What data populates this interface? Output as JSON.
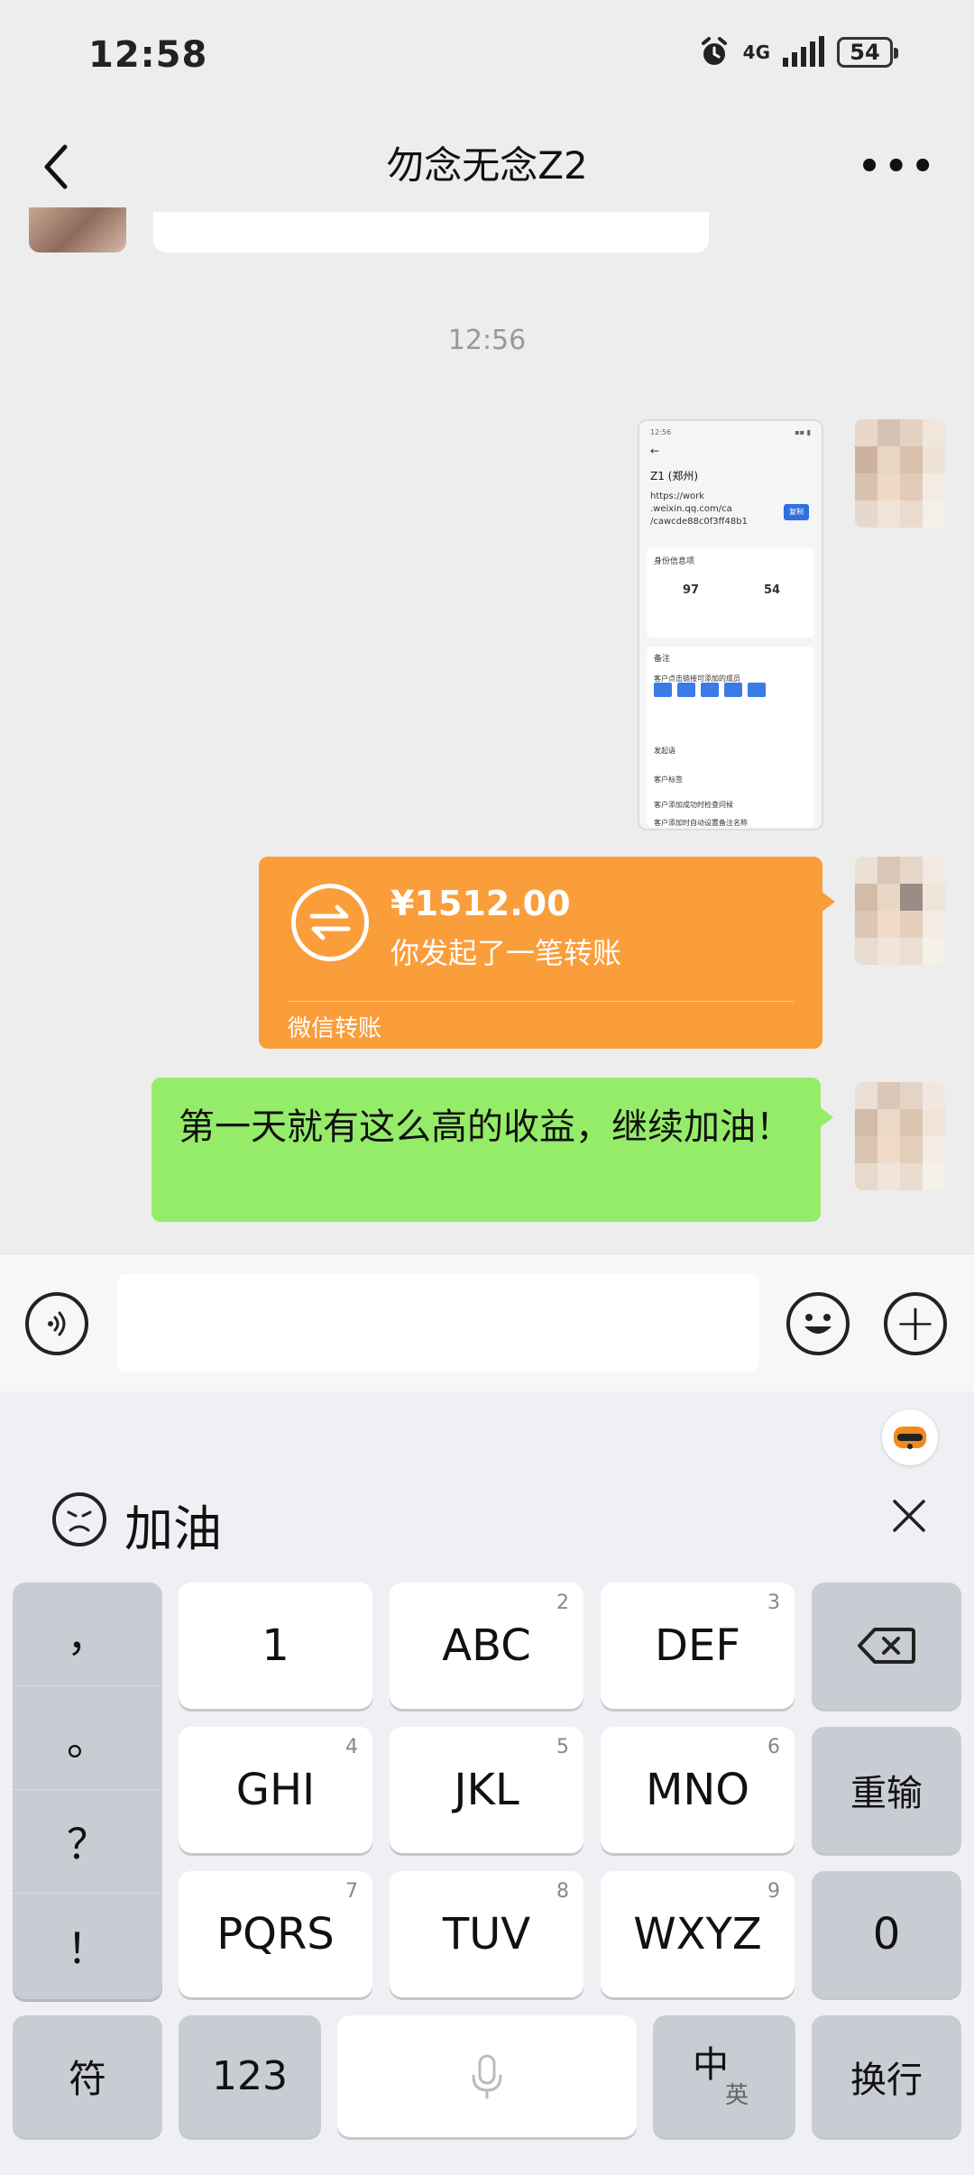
{
  "status_bar": {
    "time": "12:58",
    "network": "4G",
    "battery": "54"
  },
  "chat_header": {
    "title": "勿念无念Z2"
  },
  "messages": {
    "timestamp": "12:56",
    "shared_screenshot": {
      "time": "12:56",
      "contact": "Z1 (郑州)",
      "url_lines": [
        "https://work",
        ".weixin.qq.com/ca",
        "/cawcde88c0f3ff48b1"
      ],
      "button": "复制",
      "section": "身份信息项",
      "stat1": "97",
      "stat2": "54",
      "items": [
        "备注",
        "客户点击链接可添加的成员",
        "发起语",
        "客户标签",
        "客户添加成功时检查问候",
        "客户添加时自动设置备注名称"
      ]
    },
    "transfer": {
      "amount": "¥1512.00",
      "description": "你发起了一笔转账",
      "label": "微信转账"
    },
    "text": "第一天就有这么高的收益，继续加油！"
  },
  "keyboard": {
    "candidate": "加油",
    "punctuation": [
      "，",
      "。",
      "？",
      "！"
    ],
    "keys": [
      {
        "label": "1",
        "sup": ""
      },
      {
        "label": "ABC",
        "sup": "2"
      },
      {
        "label": "DEF",
        "sup": "3"
      },
      {
        "label": "GHI",
        "sup": "4"
      },
      {
        "label": "JKL",
        "sup": "5"
      },
      {
        "label": "MNO",
        "sup": "6"
      },
      {
        "label": "PQRS",
        "sup": "7"
      },
      {
        "label": "TUV",
        "sup": "8"
      },
      {
        "label": "WXYZ",
        "sup": "9"
      }
    ],
    "reenter": "重输",
    "zero": "0",
    "symbols": "符",
    "numbers": "123",
    "lang_main": "中",
    "lang_sub": "英",
    "newline": "换行"
  },
  "colors": {
    "transfer": "#fa9d3b",
    "sent_bubble": "#95ec69",
    "background": "#ededed"
  }
}
